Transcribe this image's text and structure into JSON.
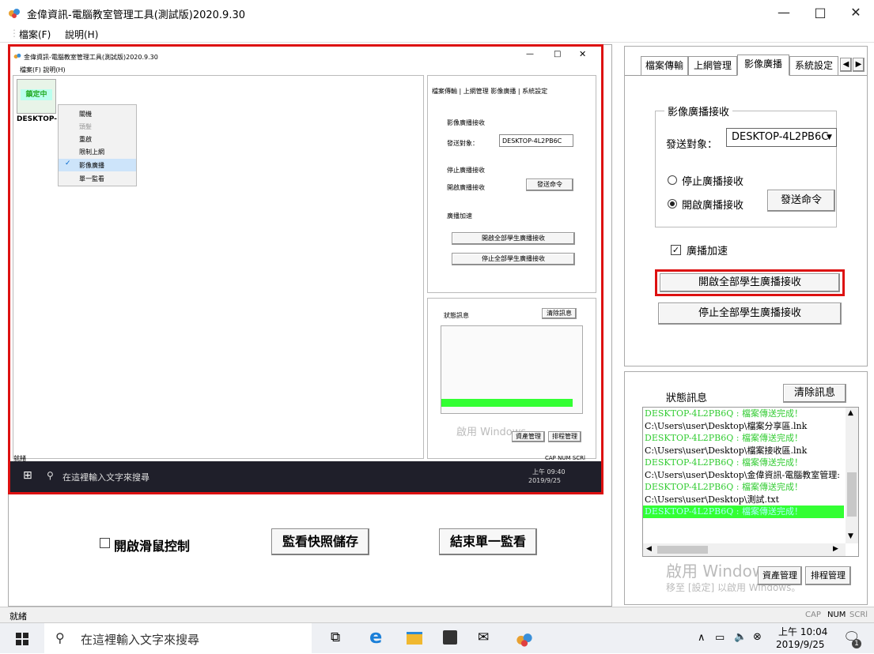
{
  "window": {
    "title": "金偉資訊-電腦教室管理工具(測試版)2020.9.30",
    "minimize": "—",
    "maximize": "□",
    "close": "✕"
  },
  "menu": {
    "file": "檔案(F)",
    "help": "說明(H)"
  },
  "remote": {
    "title": "金偉資訊-電腦教室管理工具(測試版)2020.9.30",
    "menu": "檔案(F)  說明(H)",
    "badge": "鎖定中",
    "client": "DESKTOP-",
    "context_menu": [
      "關機",
      "頭髮",
      "重啟",
      "限制上網",
      "影像廣播",
      "單一監看"
    ],
    "tabs": "檔案傳輸 | 上網管理  影像廣播 | 系統設定",
    "group": "影像廣播接收",
    "target_label": "發送對象：",
    "target_value": "DESKTOP-4L2PB6C",
    "radio_stop": "停止廣播接收",
    "radio_start": "開啟廣播接收",
    "send": "發送命令",
    "accel": "廣播加速",
    "start_all": "開啟全部學生廣播接收",
    "stop_all": "停止全部學生廣播接收",
    "status_title": "狀態訊息",
    "clear": "清除訊息",
    "watermark": "啟用 Windows",
    "asset": "資產管理",
    "schedule": "排程管理",
    "ready": "就緒",
    "caps": "CAP NUM SCRl",
    "search": "在這裡輸入文字來搜尋",
    "time": "上午 09:40",
    "date": "2019/9/25"
  },
  "bottom": {
    "mouse_control": "開啟滑鼠控制",
    "save_snapshot": "監看快照儲存",
    "end_monitor": "結束單一監看"
  },
  "tabs": [
    "檔案傳輸",
    "上網管理",
    "影像廣播",
    "系統設定"
  ],
  "broadcast": {
    "group_label": "影像廣播接收",
    "target_label": "發送對象：",
    "target_value": "DESKTOP-4L2PB6C",
    "radio_stop": "停止廣播接收",
    "radio_start": "開啟廣播接收",
    "send_button": "發送命令",
    "accel_label": "廣播加速",
    "start_all": "開啟全部學生廣播接收",
    "stop_all": "停止全部學生廣播接收"
  },
  "status": {
    "title": "狀態訊息",
    "clear_button": "清除訊息",
    "log": [
      "DESKTOP-4L2PB6Q : 檔案傳送完成！",
      "C:\\Users\\user\\Desktop\\檔案分享區.lnk",
      "DESKTOP-4L2PB6Q : 檔案傳送完成！",
      "C:\\Users\\user\\Desktop\\檔案接收區.lnk",
      "DESKTOP-4L2PB6Q : 檔案傳送完成！",
      "C:\\Users\\user\\Desktop\\金偉資訊-電腦教室管理:",
      "DESKTOP-4L2PB6Q : 檔案傳送完成！",
      "C:\\Users\\user\\Desktop\\測試.txt",
      "DESKTOP-4L2PB6Q : 檔案傳送完成！"
    ],
    "watermark1": "啟用 Windows",
    "watermark2": "移至 [設定] 以啟用 Windows。",
    "asset_button": "資產管理",
    "schedule_button": "排程管理"
  },
  "statusbar": {
    "ready": "就緒",
    "cap": "CAP",
    "num": "NUM",
    "scrl": "SCRl"
  },
  "taskbar": {
    "search_placeholder": "在這裡輸入文字來搜尋",
    "time": "上午 10:04",
    "date": "2019/9/25",
    "notif_count": "1"
  },
  "colors": {
    "accent_red": "#d11111",
    "log_green": "#33cc33",
    "log_highlight": "#33ff33"
  }
}
